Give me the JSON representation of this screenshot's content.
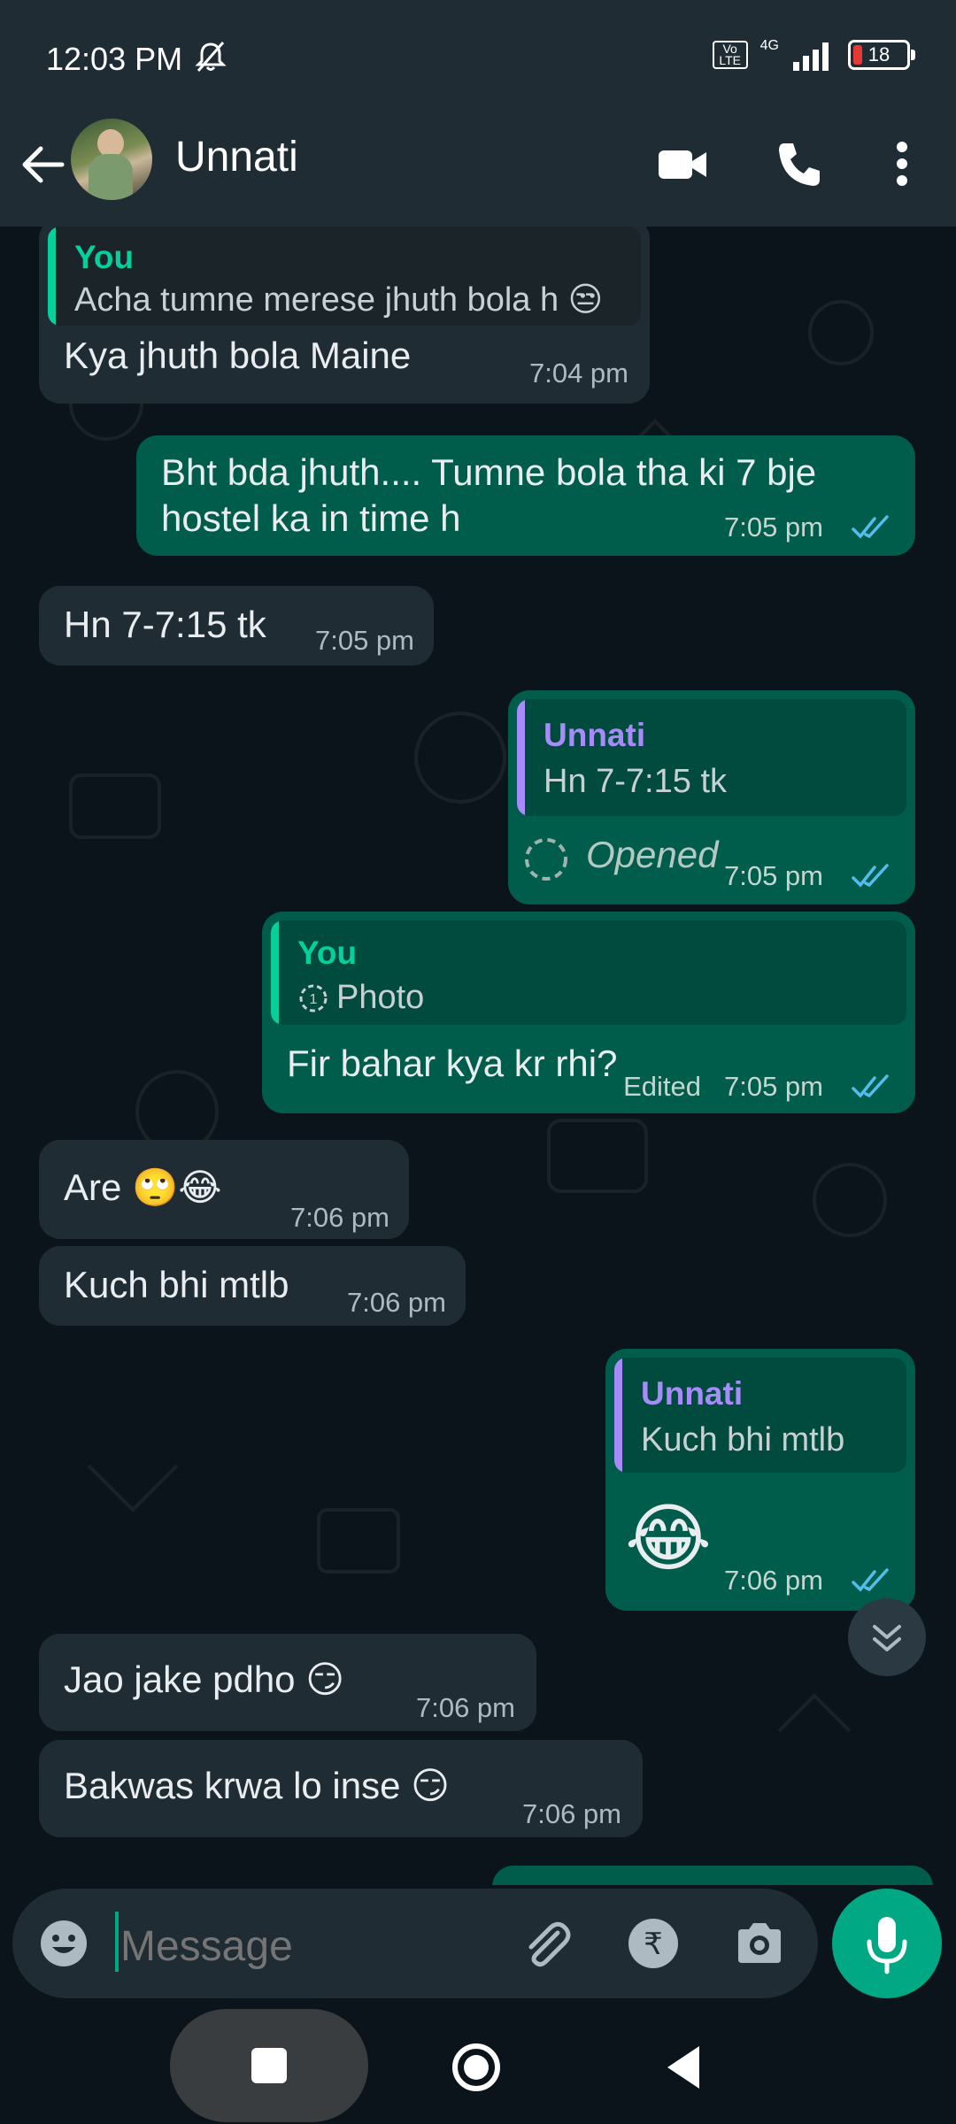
{
  "status_bar": {
    "time": "12:03 PM",
    "network": "4G",
    "volte": "Vo LTE",
    "battery": "18"
  },
  "header": {
    "contact_name": "Unnati"
  },
  "messages": [
    {
      "dir": "in",
      "quote_author": "You",
      "quote_text": "Acha tumne merese jhuth bola h 😒",
      "text": "Kya jhuth bola Maine",
      "time": "7:04 pm"
    },
    {
      "dir": "out",
      "text_line1": "Bht bda jhuth.... Tumne bola tha ki 7 bje",
      "text_line2": "hostel ka in time h",
      "time": "7:05 pm"
    },
    {
      "dir": "in",
      "text": "Hn 7-7:15 tk",
      "time": "7:05 pm"
    },
    {
      "dir": "out",
      "quote_author": "Unnati",
      "quote_text": "Hn 7-7:15 tk",
      "text": "Opened",
      "time": "7:05 pm"
    },
    {
      "dir": "out",
      "quote_author": "You",
      "quote_text": "Photo",
      "text": "Fir bahar kya kr rhi?",
      "edited": "Edited",
      "time": "7:05 pm"
    },
    {
      "dir": "in",
      "text": "Are 🙄😂",
      "time": "7:06 pm"
    },
    {
      "dir": "in",
      "text": "Kuch bhi mtlb",
      "time": "7:06 pm"
    },
    {
      "dir": "out",
      "quote_author": "Unnati",
      "quote_text": "Kuch bhi mtlb",
      "text": "😂",
      "time": "7:06 pm"
    },
    {
      "dir": "in",
      "text": "Jao jake pdho 😏",
      "time": "7:06 pm"
    },
    {
      "dir": "in",
      "text": "Bakwas krwa lo inse 😏",
      "time": "7:06 pm"
    }
  ],
  "composer": {
    "placeholder": "Message"
  },
  "colors": {
    "header_bg": "#1f2c34",
    "chat_bg": "#0b141a",
    "incoming_bubble": "#202c33",
    "outgoing_bubble": "#005c4b",
    "accent": "#00a884",
    "read_ticks": "#53bdeb",
    "quote_you": "#06cf9c",
    "quote_other": "#a78bfa"
  }
}
